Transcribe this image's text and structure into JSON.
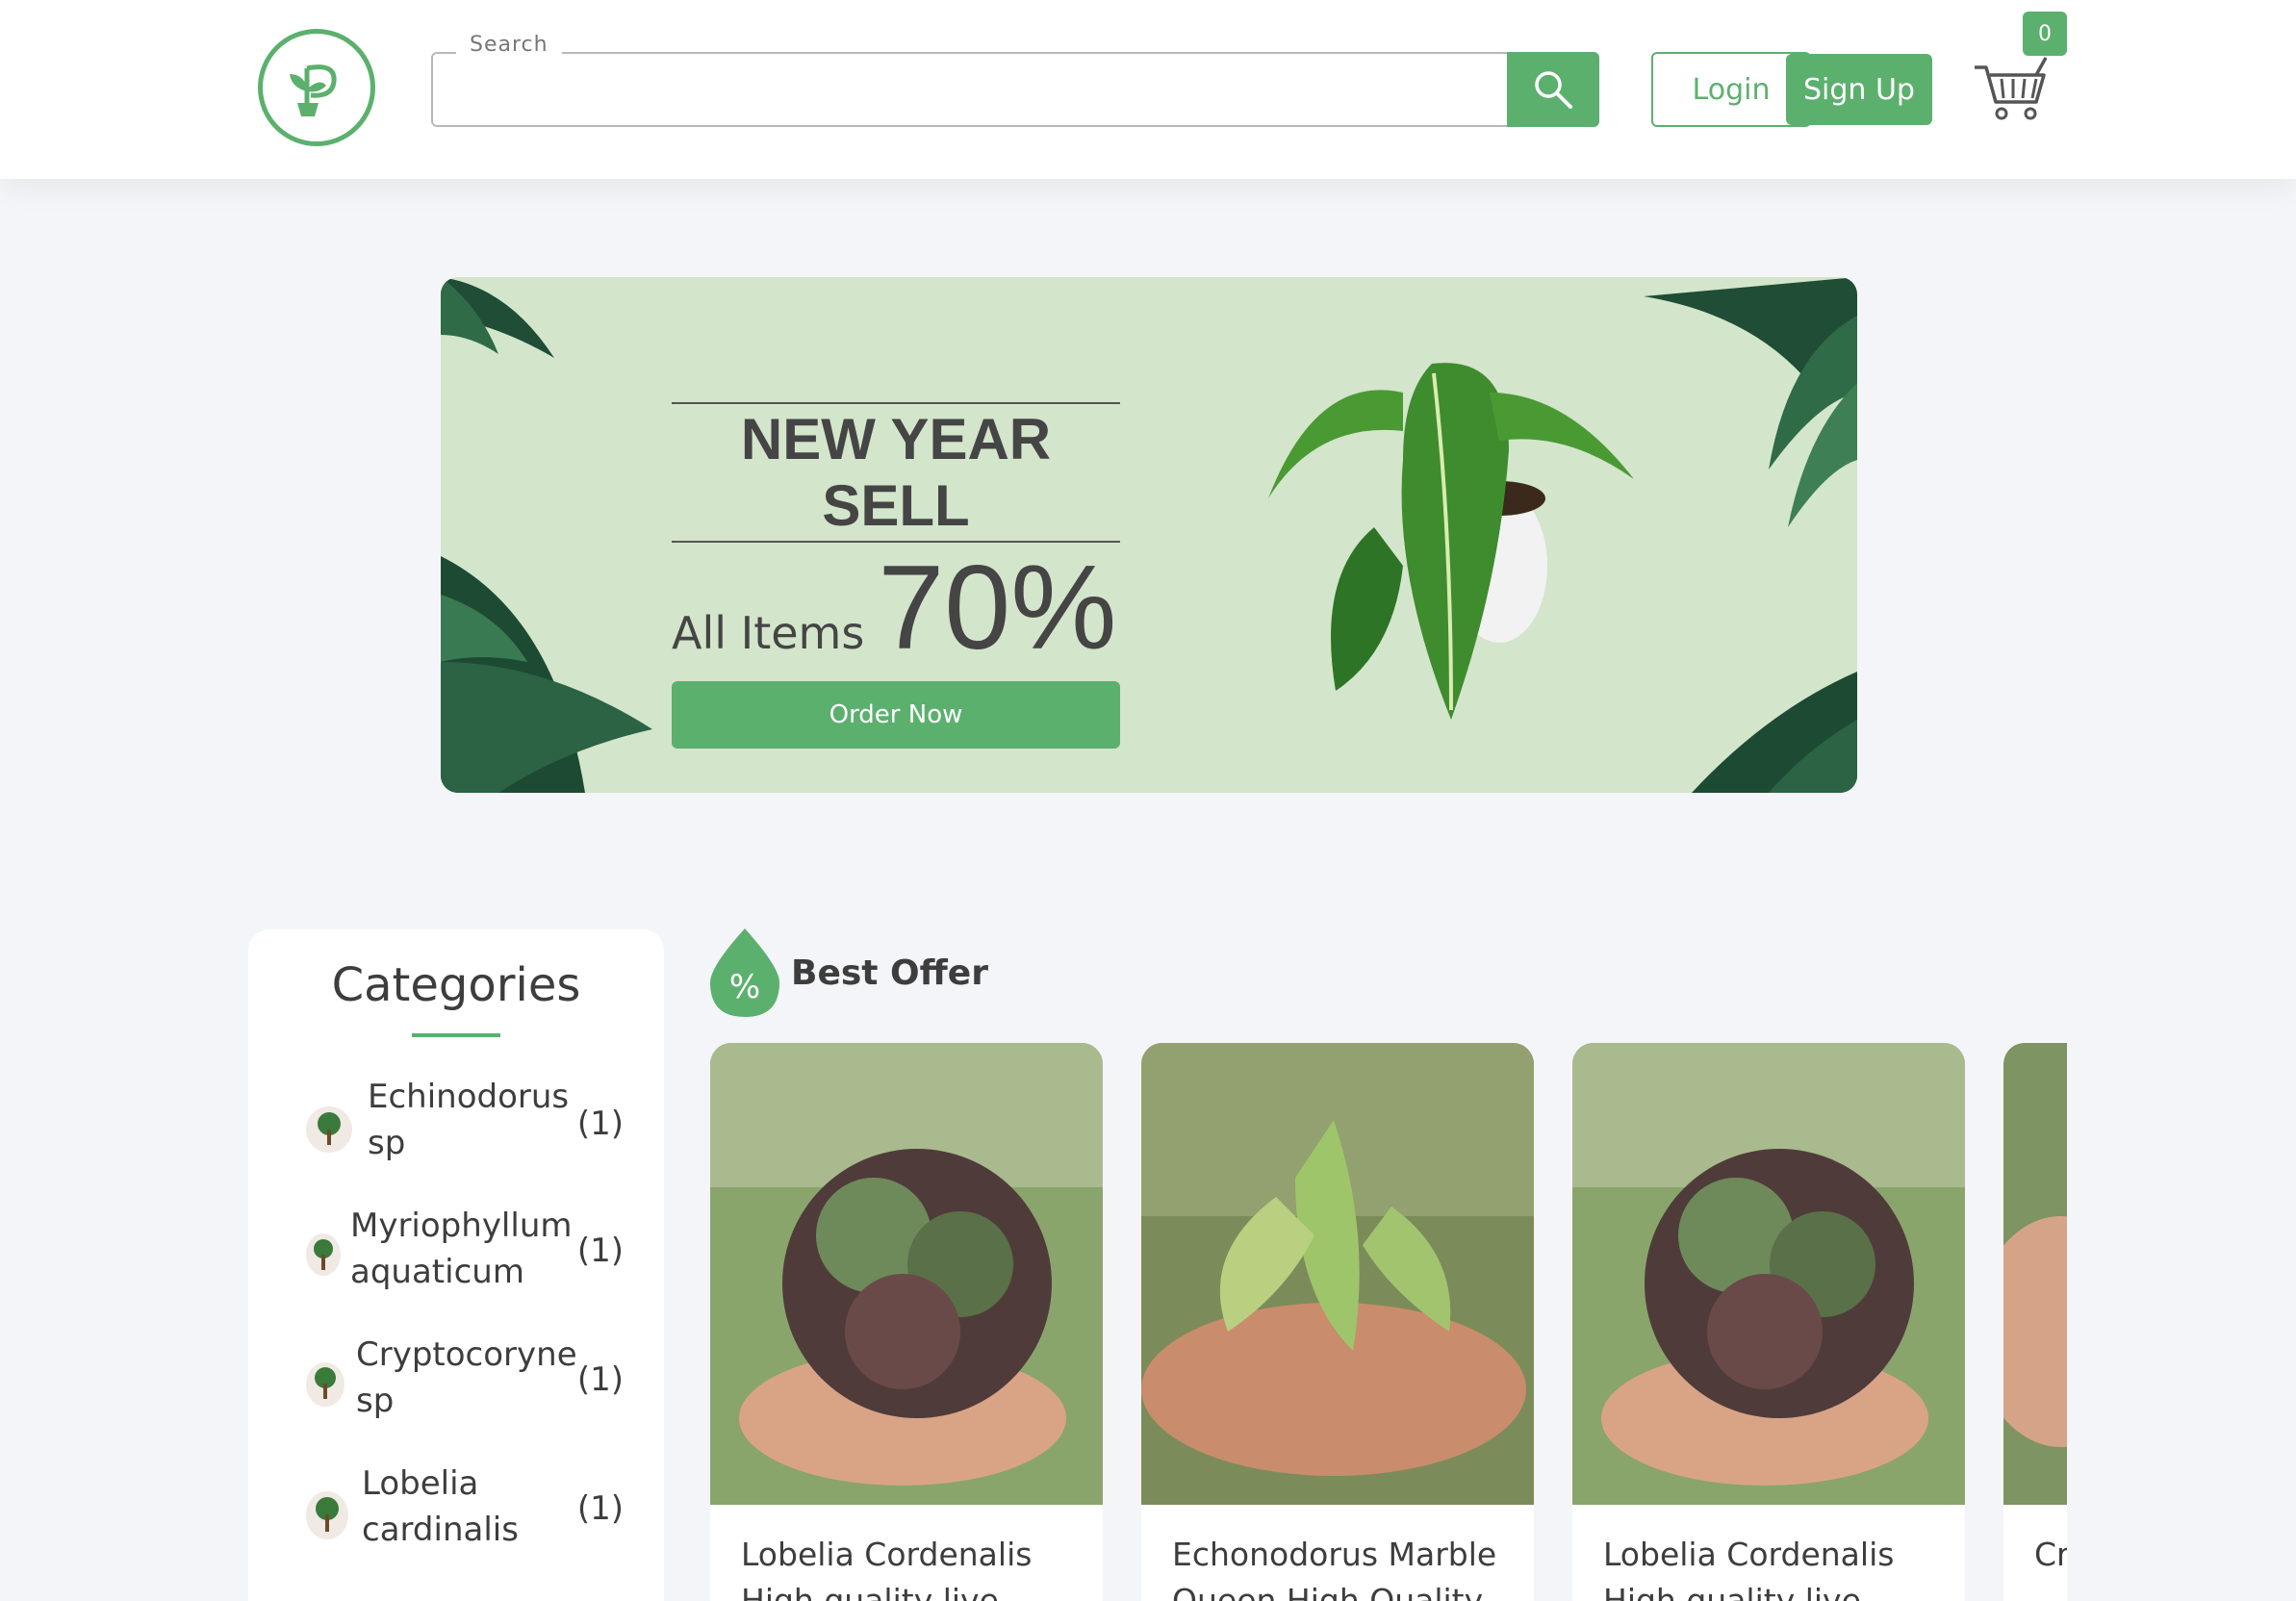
{
  "header": {
    "search_label": "Search",
    "search_value": "",
    "login_label": "Login",
    "signup_label": "Sign Up",
    "cart_count": "0"
  },
  "banner": {
    "title": "NEW YEAR SELL",
    "items_label": "All Items",
    "percent": "70%",
    "order_label": "Order Now"
  },
  "categories": {
    "title": "Categories",
    "items": [
      {
        "name_line1": "Echinodorus",
        "name_line2": "sp",
        "count": "(1)"
      },
      {
        "name_line1": "Myriophyllum",
        "name_line2": "aquaticum",
        "count": "(1)"
      },
      {
        "name_line1": "Cryptocoryne",
        "name_line2": "sp",
        "count": "(1)"
      },
      {
        "name_line1": "Lobelia",
        "name_line2": "cardinalis",
        "count": "(1)"
      }
    ]
  },
  "best_offer": {
    "title": "Best Offer",
    "icon_text": "%",
    "products": [
      {
        "title": "Lobelia Cordenalis High quality live"
      },
      {
        "title": "Echonodorus Marble Queen High Quality"
      },
      {
        "title": "Lobelia Cordenalis High quality live"
      },
      {
        "title": "Cr hi"
      }
    ]
  },
  "colors": {
    "accent": "#5cb06e",
    "banner_bg": "#d3e5cb",
    "page_bg": "#f4f5f9"
  }
}
